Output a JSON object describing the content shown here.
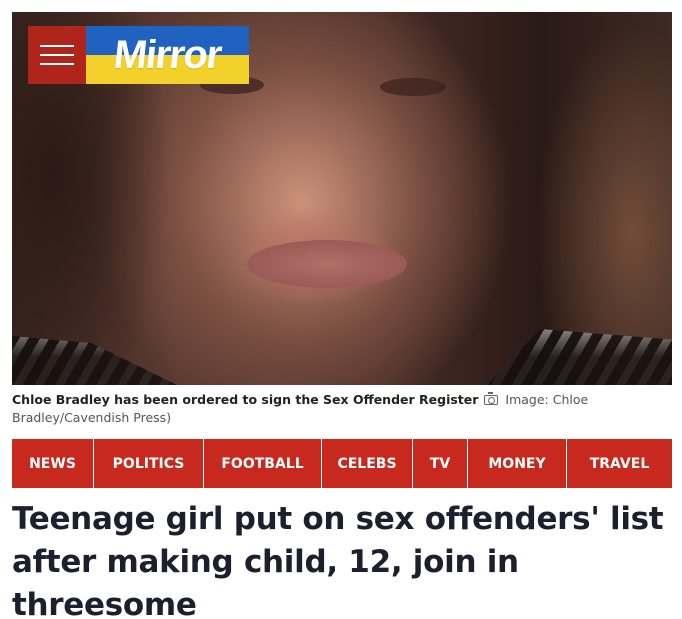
{
  "brand": {
    "logo_text": "Mirror",
    "primary_color": "#c8291e",
    "logo_colors": [
      "#1f62c0",
      "#f2d22a"
    ],
    "menu_icon": "hamburger-icon"
  },
  "hero": {
    "caption": "Chloe Bradley has been ordered to sign the Sex Offender Register",
    "credit_icon": "camera-icon",
    "credit": "Image: Chloe Bradley/Cavendish Press)"
  },
  "nav": {
    "items": [
      {
        "label": "NEWS"
      },
      {
        "label": "POLITICS"
      },
      {
        "label": "FOOTBALL"
      },
      {
        "label": "CELEBS"
      },
      {
        "label": "TV"
      },
      {
        "label": "MONEY"
      },
      {
        "label": "TRAVEL"
      }
    ]
  },
  "article": {
    "headline": "Teenage girl put on sex offenders' list after making child, 12, join in threesome"
  }
}
